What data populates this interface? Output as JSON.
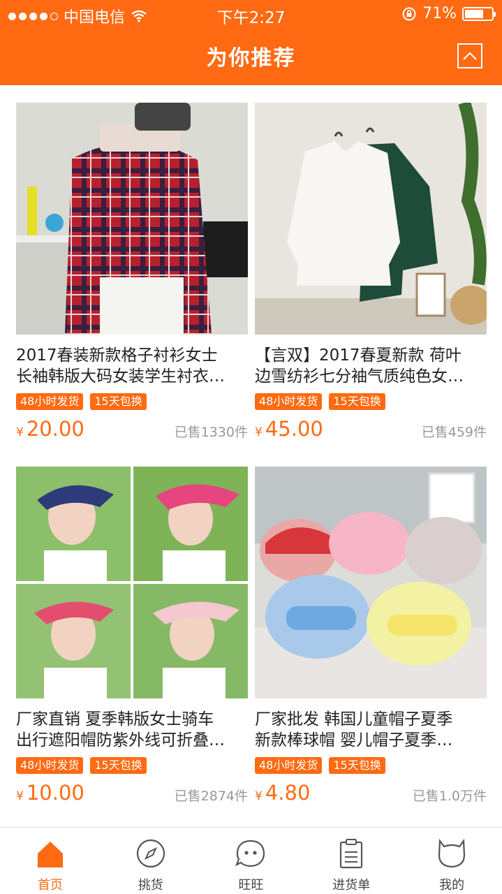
{
  "status_bar": {
    "carrier": "中国电信",
    "time": "下午2:27",
    "battery": "71%",
    "battery_level": 0.71
  },
  "header": {
    "title": "为你推荐",
    "top_button_icon": "chevron-up-icon"
  },
  "products": [
    {
      "title_line1": "2017春装新款格子衬衫女士",
      "title_line2": "长袖韩版大码女装学生衬衣…",
      "tags": [
        "48小时发货",
        "15天包换"
      ],
      "currency": "¥",
      "price": "20.00",
      "sold": "已售1330件",
      "image": "plaid-shirt-photo"
    },
    {
      "title_line1": "【言双】2017春夏新款 荷叶",
      "title_line2": "边雪纺衫七分袖气质纯色女…",
      "tags": [
        "48小时发货",
        "15天包换"
      ],
      "currency": "¥",
      "price": "45.00",
      "sold": "已售459件",
      "image": "chiffon-blouses-photo"
    },
    {
      "title_line1": "厂家直销 夏季韩版女士骑车",
      "title_line2": "出行遮阳帽防紫外线可折叠…",
      "tags": [
        "48小时发货",
        "15天包换"
      ],
      "currency": "¥",
      "price": "10.00",
      "sold": "已售2874件",
      "image": "sun-visor-hats-photo"
    },
    {
      "title_line1": "厂家批发 韩国儿童帽子夏季",
      "title_line2": "新款棒球帽 婴儿帽子夏季…",
      "tags": [
        "48小时发货",
        "15天包换"
      ],
      "currency": "¥",
      "price": "4.80",
      "sold": "已售1.0万件",
      "image": "baby-caps-photo"
    }
  ],
  "tabbar": [
    {
      "label": "首页",
      "icon": "home-icon",
      "active": true
    },
    {
      "label": "挑货",
      "icon": "compass-icon",
      "active": false
    },
    {
      "label": "旺旺",
      "icon": "chat-face-icon",
      "active": false
    },
    {
      "label": "进货单",
      "icon": "clipboard-icon",
      "active": false
    },
    {
      "label": "我的",
      "icon": "profile-icon",
      "active": false
    }
  ],
  "colors": {
    "accent": "#ff6a13",
    "text": "#222222",
    "muted": "#999999"
  }
}
